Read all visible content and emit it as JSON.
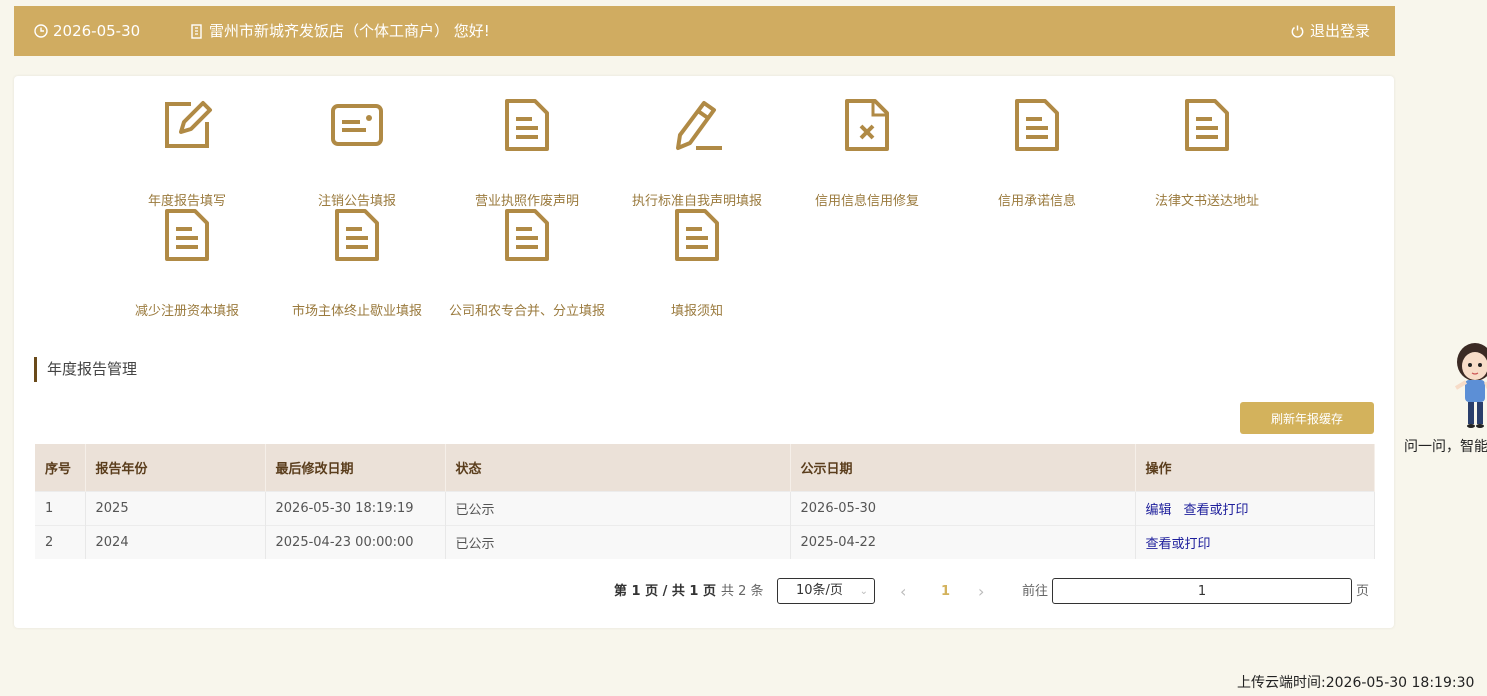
{
  "header": {
    "date": "2026-05-30",
    "shop_greeting": "雷州市新城齐发饭店（个体工商户） 您好!",
    "logout_label": "退出登录"
  },
  "menu": [
    {
      "label": "年度报告填写",
      "icon": "edit-icon"
    },
    {
      "label": "注销公告填报",
      "icon": "card-icon"
    },
    {
      "label": "营业执照作废声明",
      "icon": "document-icon"
    },
    {
      "label": "执行标准自我声明填报",
      "icon": "pen-icon"
    },
    {
      "label": "信用信息信用修复",
      "icon": "document-x-icon"
    },
    {
      "label": "信用承诺信息",
      "icon": "document-icon"
    },
    {
      "label": "法律文书送达地址",
      "icon": "document-icon"
    },
    {
      "label": "减少注册资本填报",
      "icon": "document-icon"
    },
    {
      "label": "市场主体终止歇业填报",
      "icon": "document-icon"
    },
    {
      "label": "公司和农专合并、分立填报",
      "icon": "document-icon"
    },
    {
      "label": "填报须知",
      "icon": "document-icon"
    }
  ],
  "section": {
    "title": "年度报告管理",
    "refresh_label": "刷新年报缓存"
  },
  "table": {
    "headers": [
      "序号",
      "报告年份",
      "最后修改日期",
      "状态",
      "公示日期",
      "操作"
    ],
    "rows": [
      {
        "no": "1",
        "year": "2025",
        "modified": "2026-05-30 18:19:19",
        "status": "已公示",
        "publish": "2026-05-30",
        "actions": [
          "编辑",
          "查看或打印"
        ]
      },
      {
        "no": "2",
        "year": "2024",
        "modified": "2025-04-23 00:00:00",
        "status": "已公示",
        "publish": "2025-04-22",
        "actions": [
          "查看或打印"
        ]
      }
    ]
  },
  "pagination": {
    "summary": "第 1 页 / 共 1 页",
    "total": "共 2 条",
    "page_size": "10条/页",
    "current": "1",
    "goto_label": "前往",
    "goto_value": "1",
    "page_suffix": "页"
  },
  "assistant": {
    "text": "问一问，智能"
  },
  "footer": {
    "upload_time": "上传云端时间:2026-05-30 18:19:30"
  },
  "colors": {
    "brand": "#d0ac61",
    "icon": "#b08a45",
    "link": "#1e1f9c"
  }
}
